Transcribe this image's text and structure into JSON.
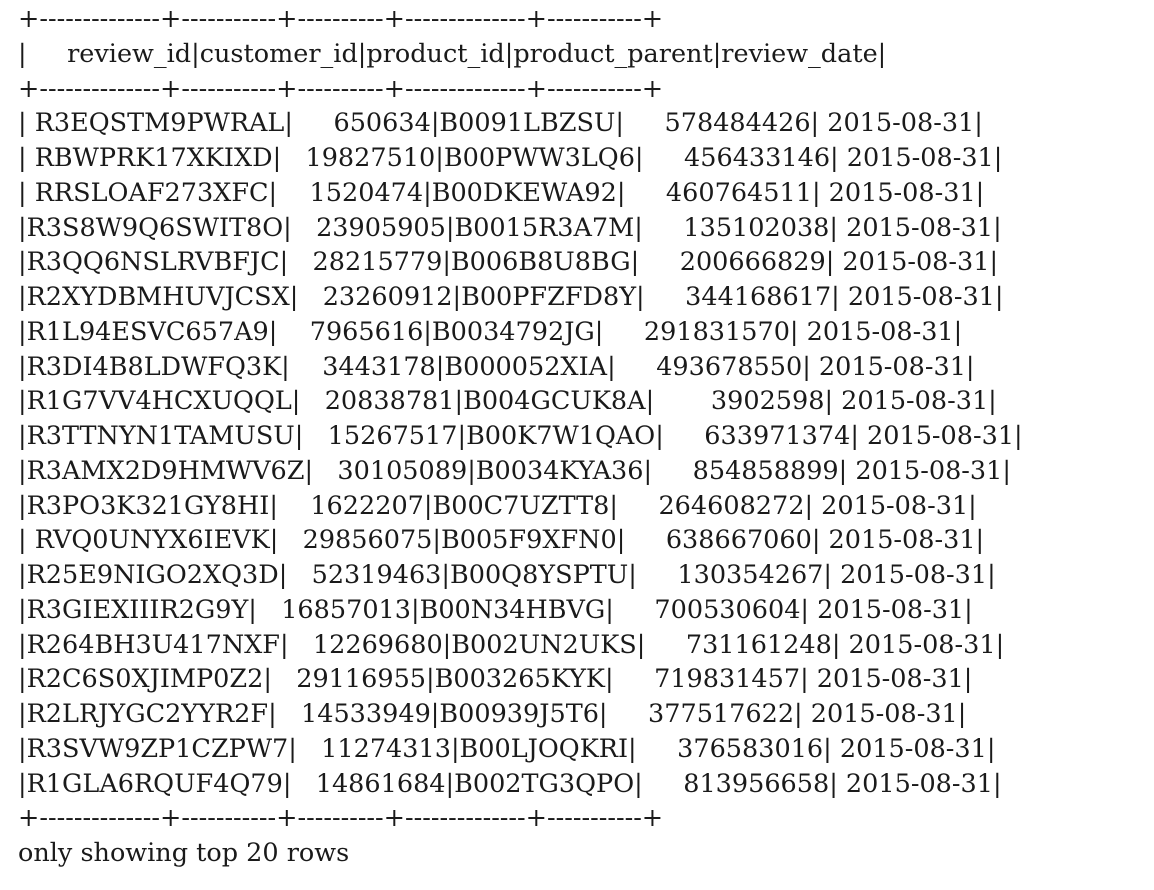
{
  "table": {
    "columns": [
      "review_id",
      "customer_id",
      "product_id",
      "product_parent",
      "review_date"
    ],
    "column_widths": [
      14,
      11,
      10,
      14,
      11
    ],
    "rows": [
      [
        "R3EQSTM9PWRAL",
        "650634",
        "B0091LBZSU",
        "578484426",
        "2015-08-31"
      ],
      [
        "RBWPRK17XKIXD",
        "19827510",
        "B00PWW3LQ6",
        "456433146",
        "2015-08-31"
      ],
      [
        "RRSLOAF273XFC",
        "1520474",
        "B00DKEWA92",
        "460764511",
        "2015-08-31"
      ],
      [
        "R3S8W9Q6SWIT8O",
        "23905905",
        "B0015R3A7M",
        "135102038",
        "2015-08-31"
      ],
      [
        "R3QQ6NSLRVBFJC",
        "28215779",
        "B006B8U8BG",
        "200666829",
        "2015-08-31"
      ],
      [
        "R2XYDBMHUVJCSX",
        "23260912",
        "B00PFZFD8Y",
        "344168617",
        "2015-08-31"
      ],
      [
        "R1L94ESVC657A9",
        "7965616",
        "B0034792JG",
        "291831570",
        "2015-08-31"
      ],
      [
        "R3DI4B8LDWFQ3K",
        "3443178",
        "B000052XIA",
        "493678550",
        "2015-08-31"
      ],
      [
        "R1G7VV4HCXUQQL",
        "20838781",
        "B004GCUK8A",
        "3902598",
        "2015-08-31"
      ],
      [
        "R3TTNYN1TAMUSU",
        "15267517",
        "B00K7W1QAO",
        "633971374",
        "2015-08-31"
      ],
      [
        "R3AMX2D9HMWV6Z",
        "30105089",
        "B0034KYA36",
        "854858899",
        "2015-08-31"
      ],
      [
        "R3PO3K321GY8HI",
        "1622207",
        "B00C7UZTT8",
        "264608272",
        "2015-08-31"
      ],
      [
        "RVQ0UNYX6IEVK",
        "29856075",
        "B005F9XFN0",
        "638667060",
        "2015-08-31"
      ],
      [
        "R25E9NIGO2XQ3D",
        "52319463",
        "B00Q8YSPTU",
        "130354267",
        "2015-08-31"
      ],
      [
        "R3GIEXIIIR2G9Y",
        "16857013",
        "B00N34HBVG",
        "700530604",
        "2015-08-31"
      ],
      [
        "R264BH3U417NXF",
        "12269680",
        "B002UN2UKS",
        "731161248",
        "2015-08-31"
      ],
      [
        "R2C6S0XJIMP0Z2",
        "29116955",
        "B003265KYK",
        "719831457",
        "2015-08-31"
      ],
      [
        "R2LRJYGC2YYR2F",
        "14533949",
        "B00939J5T6",
        "377517622",
        "2015-08-31"
      ],
      [
        "R3SVW9ZP1CZPW7",
        "11274313",
        "B00LJOQKRI",
        "376583016",
        "2015-08-31"
      ],
      [
        "R1GLA6RQUF4Q79",
        "14861684",
        "B002TG3QPO",
        "813956658",
        "2015-08-31"
      ]
    ]
  },
  "footer": "only showing top 20 rows"
}
